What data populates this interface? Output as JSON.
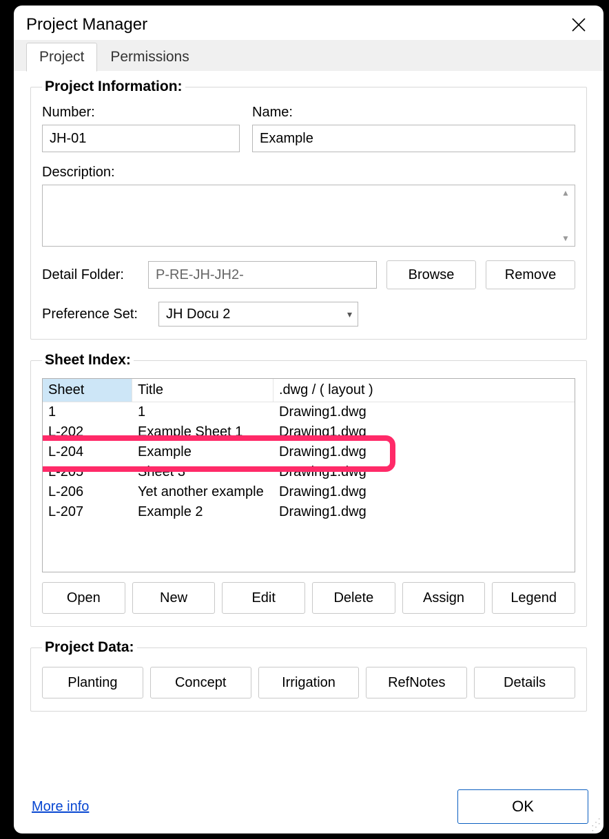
{
  "window": {
    "title": "Project Manager"
  },
  "tabs": {
    "project": "Project",
    "permissions": "Permissions",
    "active": "project"
  },
  "projectInfo": {
    "legend": "Project Information:",
    "numberLabel": "Number:",
    "numberValue": "JH-01",
    "nameLabel": "Name:",
    "nameValue": "Example",
    "descriptionLabel": "Description:",
    "descriptionValue": "",
    "detailFolderLabel": "Detail Folder:",
    "detailFolderValue": "P-RE-JH-JH2-",
    "browse": "Browse",
    "remove": "Remove",
    "preferenceSetLabel": "Preference Set:",
    "preferenceSetValue": "JH Docu 2"
  },
  "sheetIndex": {
    "legend": "Sheet Index:",
    "headers": {
      "sheet": "Sheet",
      "title": "Title",
      "dwg": ".dwg / ( layout )"
    },
    "rows": [
      {
        "sheet": "1",
        "title": "1",
        "dwg": "Drawing1.dwg"
      },
      {
        "sheet": "L-202",
        "title": "Example Sheet 1",
        "dwg": "Drawing1.dwg"
      },
      {
        "sheet": "L-204",
        "title": "Example",
        "dwg": "Drawing1.dwg"
      },
      {
        "sheet": "L-205",
        "title": "Sheet 3",
        "dwg": "Drawing1.dwg"
      },
      {
        "sheet": "L-206",
        "title": "Yet another example",
        "dwg": "Drawing1.dwg"
      },
      {
        "sheet": "L-207",
        "title": "Example 2",
        "dwg": "Drawing1.dwg"
      }
    ],
    "highlightedRowIndex": 2,
    "buttons": {
      "open": "Open",
      "new": "New",
      "edit": "Edit",
      "delete": "Delete",
      "assign": "Assign",
      "legend": "Legend"
    }
  },
  "projectData": {
    "legend": "Project Data:",
    "buttons": {
      "planting": "Planting",
      "concept": "Concept",
      "irrigation": "Irrigation",
      "refnotes": "RefNotes",
      "details": "Details"
    }
  },
  "footer": {
    "moreInfo": "More info",
    "ok": "OK"
  }
}
